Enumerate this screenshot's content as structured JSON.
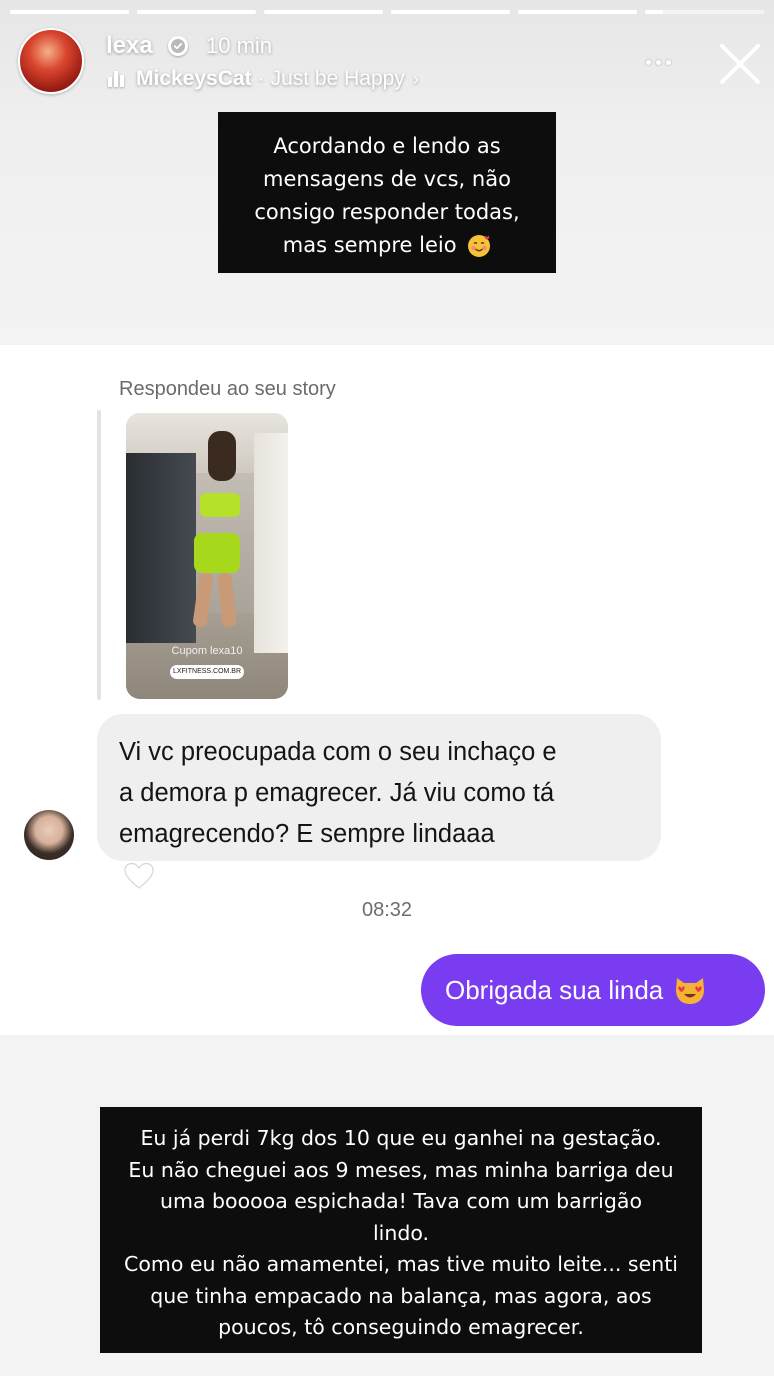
{
  "story": {
    "progress": [
      1,
      1,
      1,
      1,
      1,
      0.15
    ],
    "username": "lexa",
    "verified": true,
    "time": "10 min",
    "music": {
      "artist": "MickeysCat",
      "separator": "·",
      "song": "Just be Happy",
      "chevron": "›"
    },
    "icons": {
      "more": "more-options-icon",
      "close": "close-icon",
      "verified": "verified-badge-icon",
      "music": "music-bars-icon"
    }
  },
  "caption_top": {
    "lines": [
      "Acordando e lendo as",
      "mensagens de vcs, não",
      "consigo responder todas,",
      "mas sempre leio"
    ],
    "emoji": "smiling-face-with-hearts"
  },
  "chat": {
    "reply_label": "Respondeu ao seu story",
    "story_preview": {
      "coupon_text": "Cupom lexa10",
      "link_text": "LXFITNESS.COM.BR"
    },
    "incoming": {
      "lines": [
        "Vi vc preocupada com o seu inchaço e",
        "a demora p emagrecer. Já viu como tá",
        "emagrecendo? E sempre lindaaa"
      ],
      "emoji": "white-heart"
    },
    "timestamp": "08:32",
    "outgoing": {
      "text": "Obrigada sua linda",
      "emoji": "heart-eyes-cat"
    }
  },
  "caption_bottom": {
    "lines": [
      "Eu já perdi 7kg dos 10 que eu ganhei na gestação.",
      "Eu não cheguei aos 9 meses, mas minha barriga deu",
      "uma booooa espichada! Tava com um barrigão",
      "lindo.",
      "Como eu não amamentei, mas tive muito leite... senti",
      "que tinha empacado na balança, mas agora, aos",
      "poucos, tô conseguindo emagrecer."
    ]
  },
  "colors": {
    "outgoing_bubble": "#7a3cf0",
    "incoming_bubble": "#efefef",
    "caption_box": "#0d0d0d"
  }
}
